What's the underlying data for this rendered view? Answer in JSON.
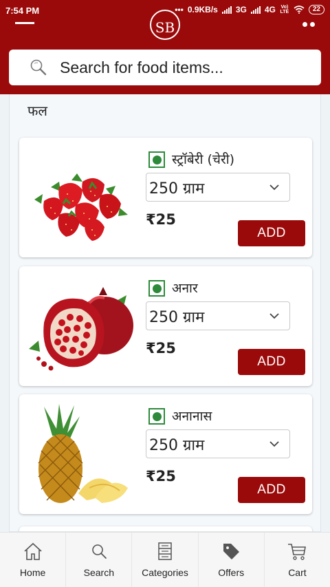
{
  "status_bar": {
    "time": "7:54 PM",
    "data_rate": "0.9KB/s",
    "network_1": "3G",
    "network_2": "4G",
    "volte": "Vo) LTE",
    "battery": "22"
  },
  "header": {
    "logo_text": "SB",
    "search_placeholder": "Search for food items..."
  },
  "section": {
    "title": "फल"
  },
  "products": [
    {
      "name": "स्ट्रॉबेरी (चेरी)",
      "quantity": "250 ग्राम",
      "price": "₹25",
      "add_label": "ADD",
      "image_icon": "strawberry-image"
    },
    {
      "name": "अनार",
      "quantity": "250 ग्राम",
      "price": "₹25",
      "add_label": "ADD",
      "image_icon": "pomegranate-image"
    },
    {
      "name": "अनानास",
      "quantity": "250 ग्राम",
      "price": "₹25",
      "add_label": "ADD",
      "image_icon": "pineapple-image"
    }
  ],
  "bottom_nav": [
    {
      "label": "Home",
      "icon": "home-icon"
    },
    {
      "label": "Search",
      "icon": "search-icon"
    },
    {
      "label": "Categories",
      "icon": "categories-icon"
    },
    {
      "label": "Offers",
      "icon": "offers-tag-icon"
    },
    {
      "label": "Cart",
      "icon": "cart-icon"
    }
  ],
  "colors": {
    "brand": "#9b0a0a",
    "veg_green": "#2c8a3a",
    "background": "#eef3f6"
  }
}
